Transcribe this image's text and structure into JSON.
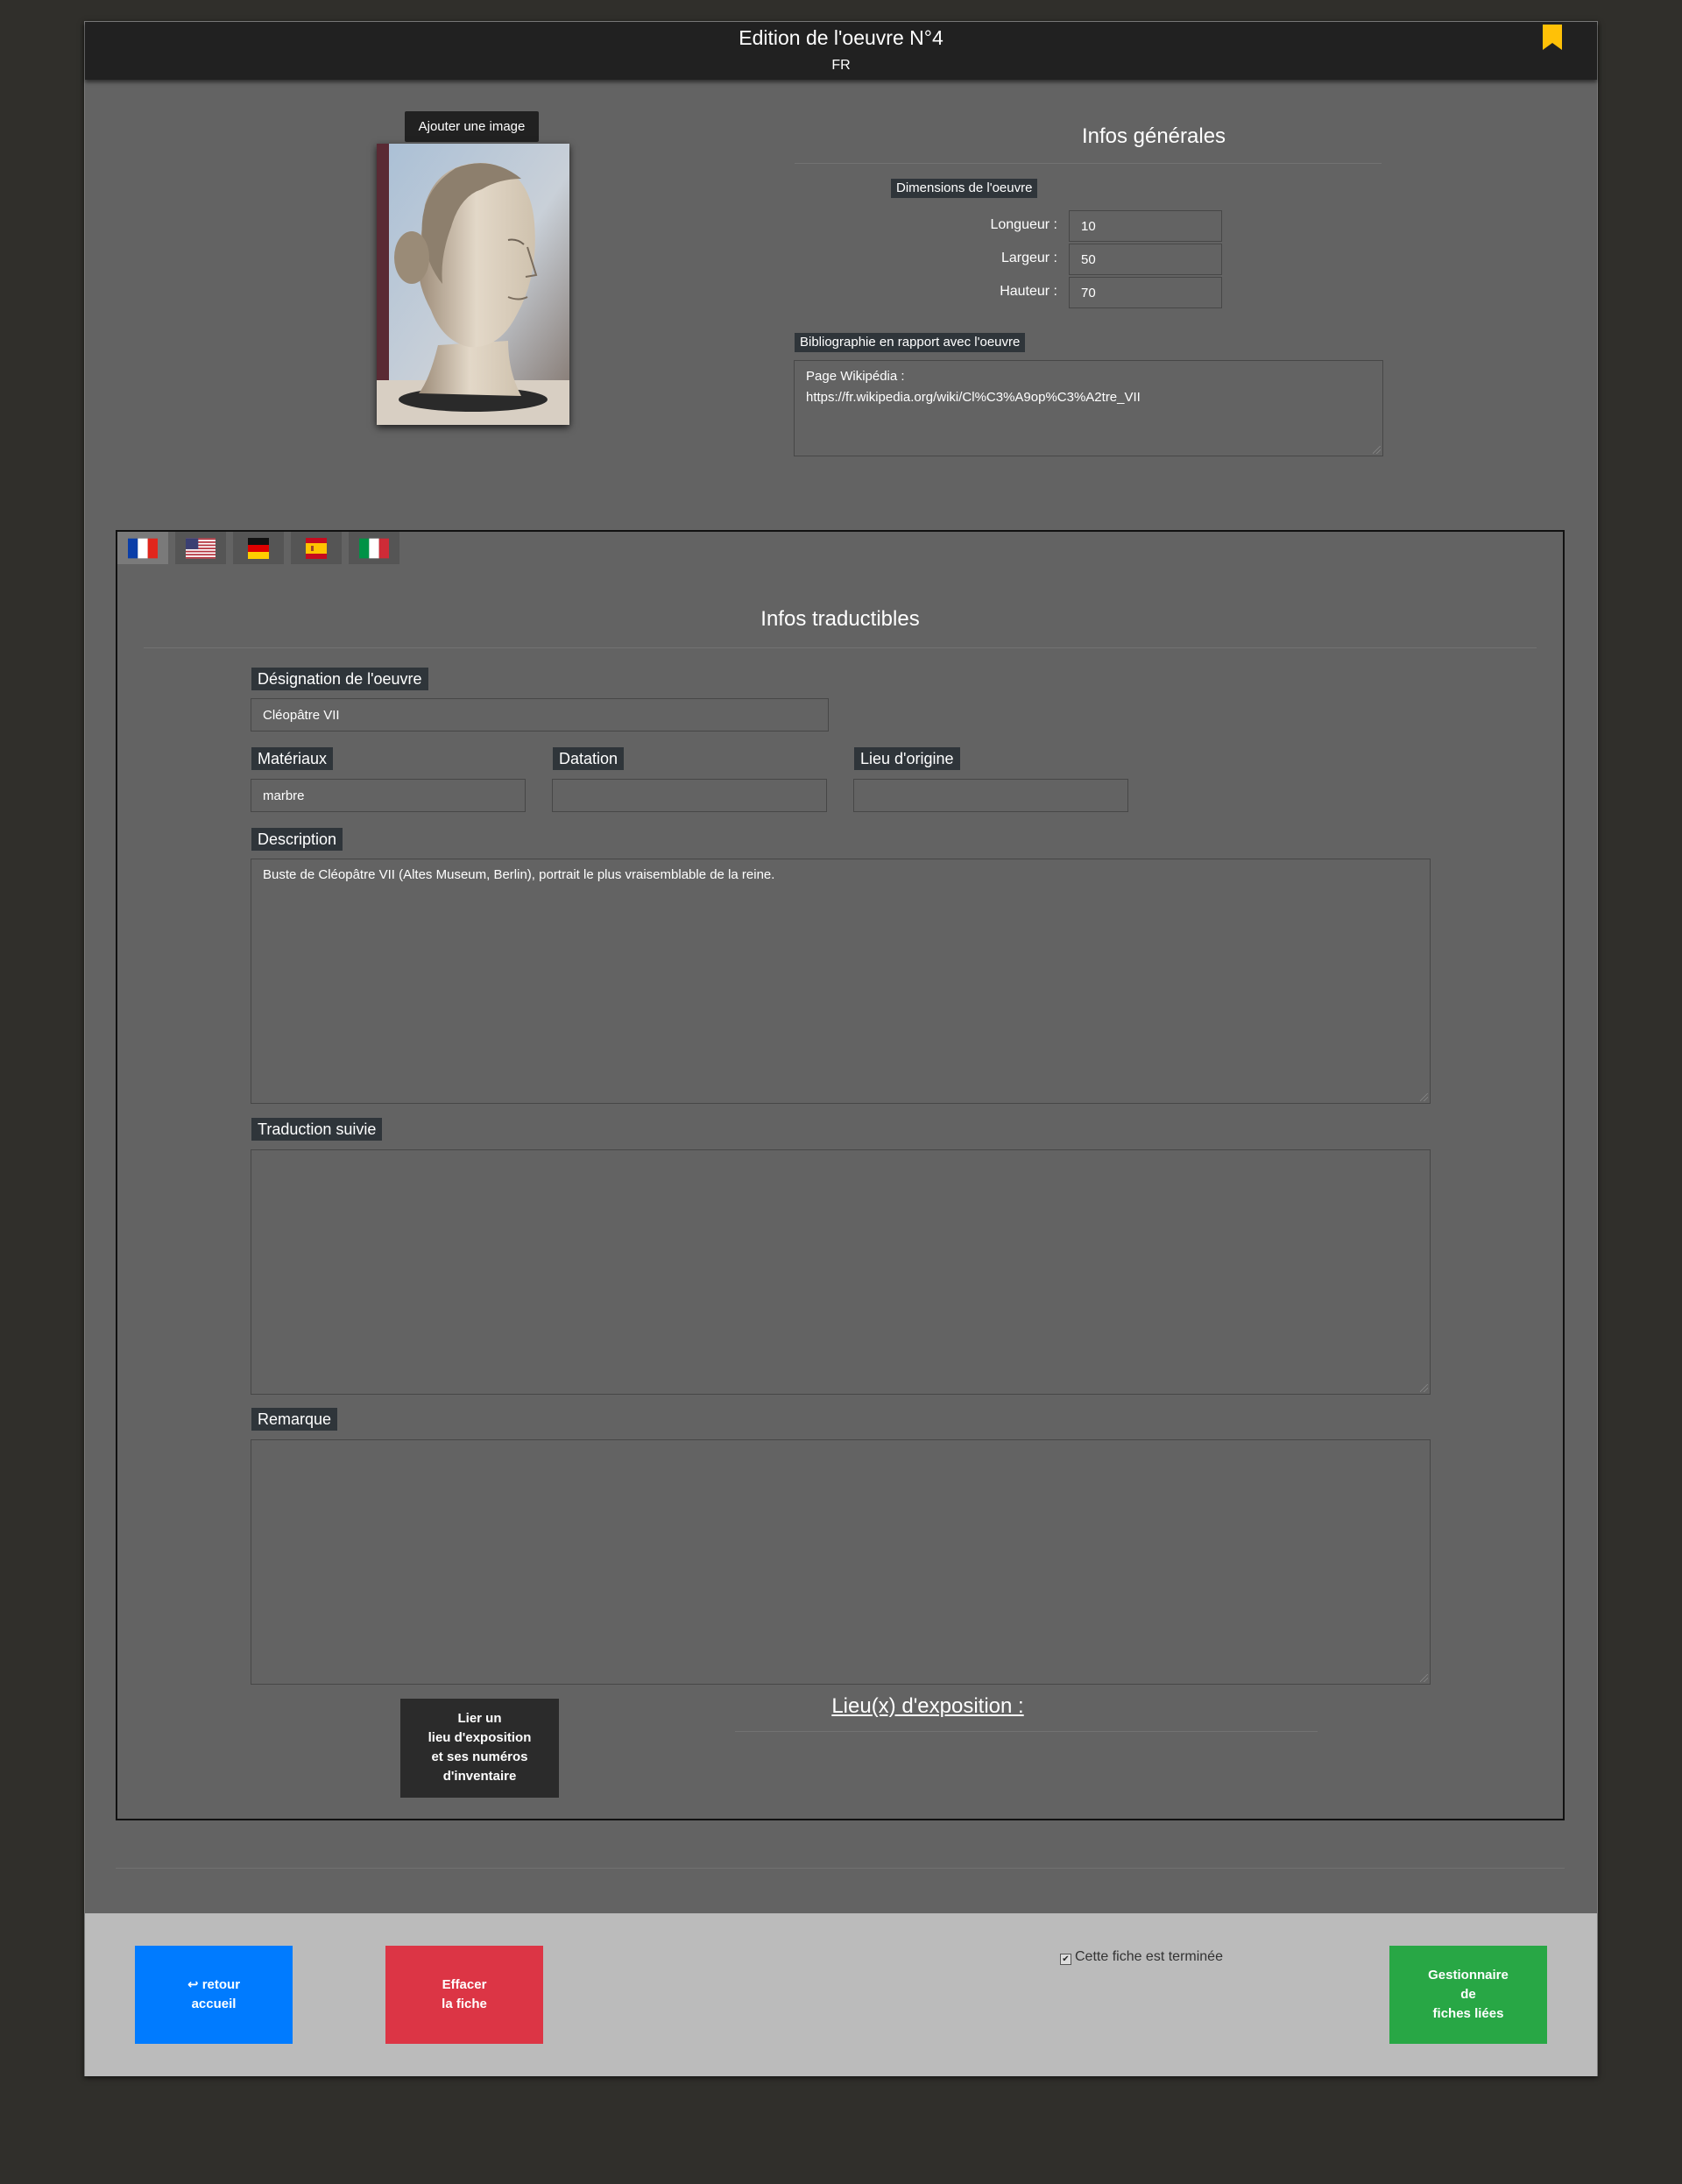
{
  "header": {
    "title": "Edition de l'oeuvre N°4",
    "lang": "FR",
    "bookmark_color": "#ffc107"
  },
  "image_section": {
    "add_image_label": "Ajouter une image"
  },
  "general": {
    "title": "Infos générales",
    "dimensions_tag": "Dimensions de l'oeuvre",
    "longueur_label": "Longueur :",
    "longueur_value": "10",
    "largeur_label": "Largeur :",
    "largeur_value": "50",
    "hauteur_label": "Hauteur :",
    "hauteur_value": "70",
    "biblio_tag": "Bibliographie en rapport avec l'oeuvre",
    "biblio_line1": "Page Wikipédia :",
    "biblio_line2": "https://fr.wikipedia.org/wiki/Cl%C3%A9op%C3%A2tre_VII"
  },
  "languages": [
    "fr-flag-icon",
    "us-flag-icon",
    "de-flag-icon",
    "es-flag-icon",
    "it-flag-icon"
  ],
  "translatable": {
    "title": "Infos traductibles",
    "designation_label": "Désignation de l'oeuvre",
    "designation_value": "Cléopâtre VII",
    "materiaux_label": "Matériaux",
    "materiaux_value": "marbre",
    "datation_label": "Datation",
    "datation_value": "",
    "lieu_label": "Lieu d'origine",
    "lieu_value": "",
    "description_label": "Description",
    "description_value": "Buste de Cléopâtre VII (Altes Museum, Berlin), portrait le plus vraisemblable de la reine.",
    "traduction_label": "Traduction suivie",
    "remarque_label": "Remarque",
    "link_button_lines": [
      "Lier un",
      "lieu d'exposition",
      "et ses numéros",
      "d'inventaire"
    ],
    "expo_title": "Lieu(x) d'exposition :"
  },
  "footer": {
    "back_label_1": "retour",
    "back_label_2": "accueil",
    "delete_label_1": "Effacer",
    "delete_label_2": "la fiche",
    "done_label": "Cette fiche est terminée",
    "manager_lines": [
      "Gestionnaire",
      "de",
      "fiches liées"
    ],
    "colors": {
      "back": "#007bff",
      "delete": "#dc3545",
      "manager": "#28a745"
    }
  }
}
